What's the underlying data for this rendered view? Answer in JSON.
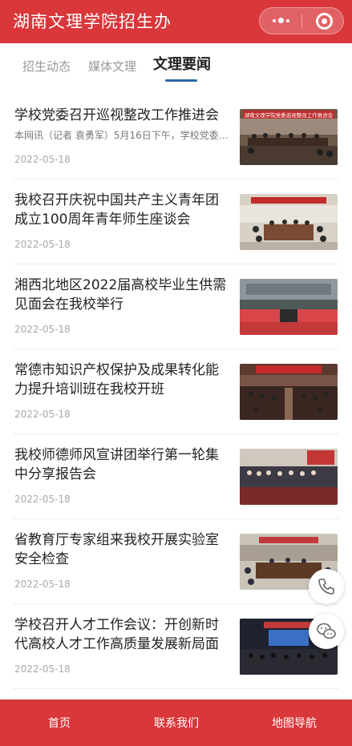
{
  "header": {
    "title": "湖南文理学院招生办"
  },
  "tabs": [
    {
      "label": "招生动态",
      "active": false
    },
    {
      "label": "媒体文理",
      "active": false
    },
    {
      "label": "文理要闻",
      "active": true
    }
  ],
  "news": [
    {
      "title": "学校党委召开巡视整改工作推进会",
      "summary": "本网讯（记者 袁勇军）5月16日下午，学校党委…",
      "date": "2022-05-18",
      "thumb_caption": "湖南文理学院党委巡视整改工作推进会"
    },
    {
      "title": "我校召开庆祝中国共产主义青年团成立100周年青年师生座谈会",
      "summary": "",
      "date": "2022-05-18"
    },
    {
      "title": "湘西北地区2022届高校毕业生供需见面会在我校举行",
      "summary": "",
      "date": "2022-05-18"
    },
    {
      "title": "常德市知识产权保护及成果转化能力提升培训班在我校开班",
      "summary": "",
      "date": "2022-05-18"
    },
    {
      "title": "我校师德师风宣讲团举行第一轮集中分享报告会",
      "summary": "",
      "date": "2022-05-18"
    },
    {
      "title": "省教育厅专家组来我校开展实验室安全检查",
      "summary": "",
      "date": "2022-05-18"
    },
    {
      "title": "学校召开人才工作会议：开创新时代高校人才工作高质量发展新局面",
      "summary": "",
      "date": "2022-05-18"
    }
  ],
  "bottom_nav": [
    {
      "label": "首页"
    },
    {
      "label": "联系我们"
    },
    {
      "label": "地图导航"
    }
  ],
  "colors": {
    "brand_red": "#d9373a",
    "tab_underline": "#2a6aa0"
  }
}
